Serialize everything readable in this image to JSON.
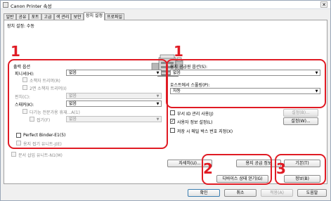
{
  "window": {
    "title": "Canon Printer 속성",
    "close_glyph": "✕"
  },
  "tabs": [
    "일반",
    "공유",
    "포트",
    "고급",
    "색 관리",
    "보안",
    "장치 설정",
    "프로파일"
  ],
  "active_tab": "장치 설정",
  "device_settings": {
    "label": "장치 설정: 수동"
  },
  "output_options": {
    "title": "출력 옵션",
    "finisher_label": "피니셔(H):",
    "finisher_value": "없음",
    "saddle_finisher_label": "소책자 트리머(R)",
    "saddle_trimmer2_label": "2면 소책자 트리머(I)",
    "punch_label": "펀치(C):",
    "punch_value": "없음",
    "stacker_label": "스태커(K):",
    "stacker_value": "없음",
    "multi_drawer_label": "다기능 전문가용 휴재...A(1)",
    "folding_label": "접기(F)",
    "folding_value": "없음",
    "perfect_binder_label": "Perfect Binder-E1(5)",
    "paper_folding_label": "용지 접기 유니트-J(E)"
  },
  "insert_unit_label": "문서 삽입 유니트-N1(M)",
  "paper_source": {
    "label": "용지 공급원 옵션(S):",
    "value": "없음",
    "host_spooling_label": "호스트에서 스풀링(P):",
    "host_spooling_value": "자동"
  },
  "dept_id": {
    "label": "부서 ID 관리 사용(J)",
    "button": "설정(B)..."
  },
  "user_info": {
    "label": "사용자 정보 설정(L)",
    "checked": true,
    "button": "설정(W)..."
  },
  "mailbox_label": "저장 시 메일 박스 번호 지정(X)",
  "buttons": {
    "details": "자세히(U)...",
    "paper_info": "용지 공급 정보",
    "device_status": "디바이스 상태 얻기(G)",
    "restore": "기본(T)",
    "about": "정보(B)"
  },
  "dialog_buttons": {
    "ok": "확인",
    "cancel": "취소",
    "apply": "적용(A)",
    "help": "도움말"
  },
  "annotations": [
    "1",
    "1",
    "2",
    "3"
  ],
  "colors": {
    "annotation": "#e01b24"
  },
  "icons": [
    "printer-icon",
    "chevron-down-icon",
    "checkmark-icon",
    "close-icon"
  ]
}
